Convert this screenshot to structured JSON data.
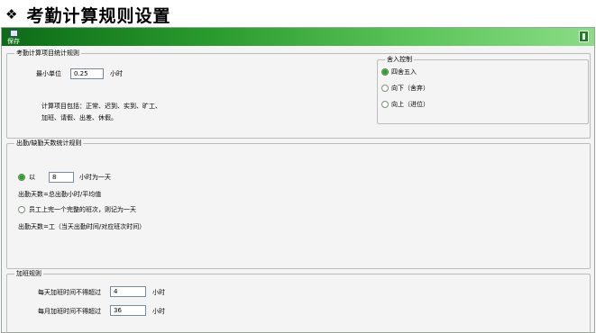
{
  "page": {
    "title": "考勤计算规则设置"
  },
  "toolbar": {
    "save_label": "保存"
  },
  "stats_section": {
    "legend": "考勤计算项目统计规则",
    "min_unit_label": "最小单位",
    "min_unit_value": "0.25",
    "min_unit_suffix": "小时",
    "items_line1": "计算项目包括：正常、迟到、实到、旷工、",
    "items_line2": "加班、请假、出差、休假。"
  },
  "rounding": {
    "legend": "舍入控制",
    "options": [
      {
        "label": "四舍五入",
        "selected": true
      },
      {
        "label": "向下（舍弃）",
        "selected": false
      },
      {
        "label": "向上（进位）",
        "selected": false
      }
    ]
  },
  "attendance_days": {
    "legend": "出勤/缺勤天数统计规则",
    "option1_prefix": "以",
    "option1_value": "8",
    "option1_suffix": "小时为一天",
    "formula1": "出勤天数=总出勤小时/平均值",
    "option2_label": "员工上完一个完整的班次，则记为一天",
    "formula2": "出勤天数=工（当天出勤时间/对应班次时间）"
  },
  "overtime": {
    "legend": "加班规则",
    "daily_label": "每天加班时间不得超过",
    "daily_value": "4",
    "daily_unit": "小时",
    "monthly_label": "每月加班时间不得超过",
    "monthly_value": "36",
    "monthly_unit": "小时"
  }
}
